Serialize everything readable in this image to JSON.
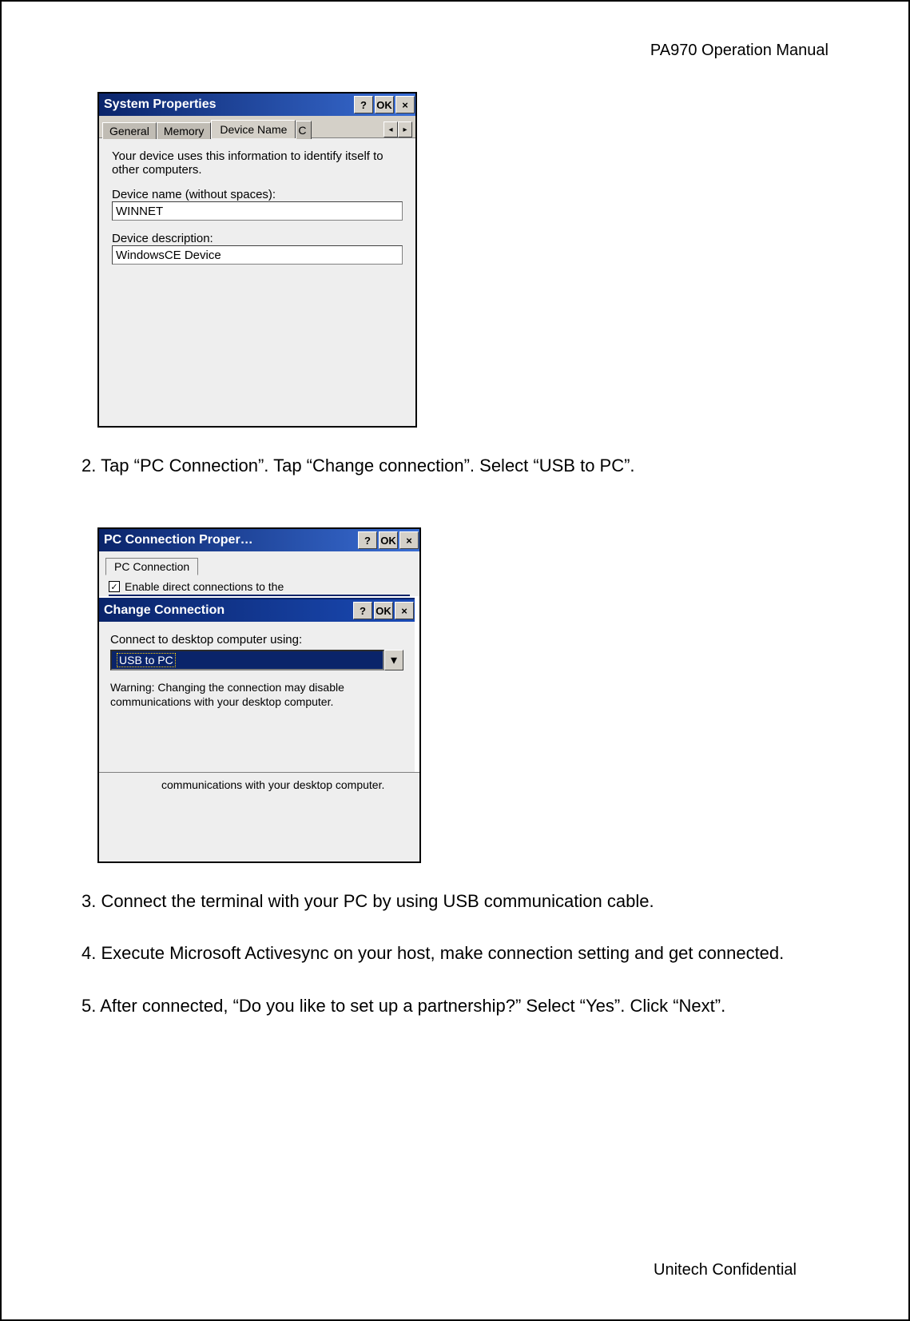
{
  "doc": {
    "header": "PA970 Operation Manual",
    "footer": "Unitech Confidential",
    "step2": "2. Tap “PC Connection”. Tap “Change connection”. Select “USB to PC”.",
    "step3": "3. Connect the terminal with your PC by using USB communication cable.",
    "step4": "4. Execute Microsoft Activesync on your host, make connection setting and get connected.",
    "step5": "5. After connected, “Do you like to set up a partnership?” Select “Yes”. Click “Next”."
  },
  "win1": {
    "title": "System Properties",
    "btn_help": "?",
    "btn_ok": "OK",
    "btn_close": "×",
    "tabs": {
      "general": "General",
      "memory": "Memory",
      "device_name": "Device Name",
      "cropped": "C"
    },
    "arrow_left": "◂",
    "arrow_right": "▸",
    "info_text": "Your device uses this information to identify itself to other computers.",
    "name_label": "Device name (without spaces):",
    "name_value": "WINNET",
    "desc_label": "Device description:",
    "desc_value": "WindowsCE Device"
  },
  "win2": {
    "back_title": "PC Connection Proper…",
    "btn_help": "?",
    "btn_ok": "OK",
    "btn_close": "×",
    "tab": "PC Connection",
    "checkbox_mark": "✓",
    "checkbox_label": "Enable direct connections to the",
    "front_title": "Change Connection",
    "connect_label": "Connect to desktop computer using:",
    "combo_value": "USB to PC",
    "combo_arrow": "▾",
    "warning": "Warning: Changing the connection may disable communications with your desktop computer.",
    "tail_text": "communications with your desktop computer."
  }
}
